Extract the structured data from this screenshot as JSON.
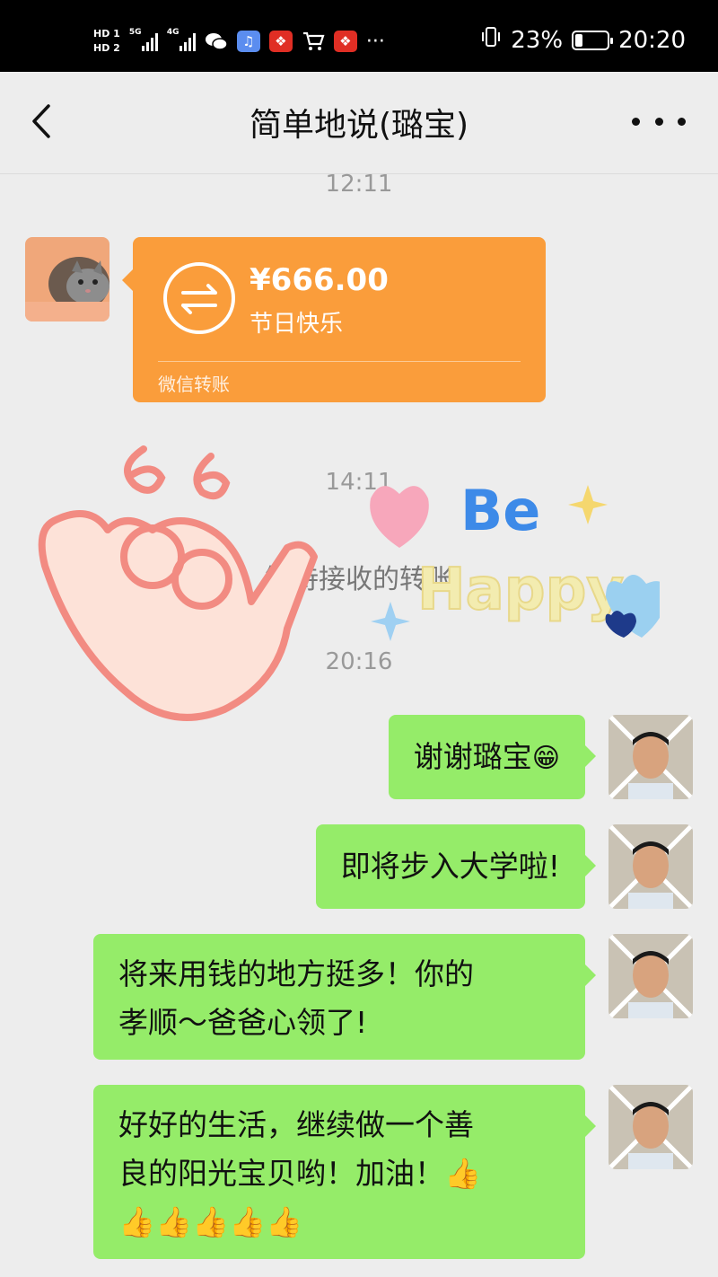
{
  "status_bar": {
    "hd1": "HD 1",
    "hd2": "HD 2",
    "net1": "5G",
    "net2": "4G",
    "more": "···",
    "battery_pct": "23%",
    "battery_level": 0.23,
    "time": "20:20",
    "icons": [
      "wechat-icon",
      "music-icon",
      "shopping-icon",
      "cart-icon",
      "shopping-icon"
    ]
  },
  "header": {
    "title": "简单地说(璐宝)",
    "back_icon": "chevron-left-icon",
    "more_icon": "ellipsis-icon"
  },
  "chat": {
    "time1": "12:11",
    "transfer": {
      "amount": "¥666.00",
      "note": "节日快乐",
      "footer": "微信转账",
      "icon": "transfer-arrows-icon",
      "color": "#fa9d3b"
    },
    "time2": "14:11",
    "system_notice": "笔待接收的转账",
    "time3": "20:16",
    "messages": [
      {
        "text": "谢谢璐宝",
        "emoji": "😁"
      },
      {
        "text": "即将步入大学啦!"
      },
      {
        "line1": "将来用钱的地方挺多！你的",
        "line2": "孝顺～爸爸心领了!"
      },
      {
        "line1": "好好的生活，继续做一个善",
        "line2": "良的阳光宝贝哟！加油！👍",
        "line3": "👍👍👍👍👍"
      }
    ],
    "bubble_color": "#95ec69"
  },
  "stickers": {
    "text_be": "Be",
    "text_happy": "Happy"
  }
}
